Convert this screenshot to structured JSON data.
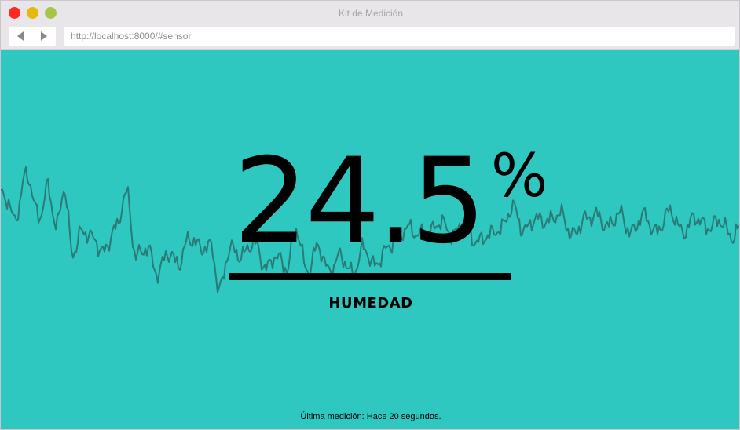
{
  "window": {
    "title": "Kit de Medición"
  },
  "toolbar": {
    "back_icon": "back-arrow-icon",
    "forward_icon": "forward-arrow-icon",
    "url": "http://localhost:8000/#sensor"
  },
  "colors": {
    "background": "#2ec8c1",
    "wave": "#2b7a76",
    "text": "#000000",
    "close": "#ff2a25",
    "minimize": "#e8b90d",
    "maximize": "#a6c548"
  },
  "sensor": {
    "value": "24.5",
    "unit": "%",
    "label": "HUMEDAD"
  },
  "footer": {
    "last_reading": "Última medición: Hace 20 segundos."
  }
}
